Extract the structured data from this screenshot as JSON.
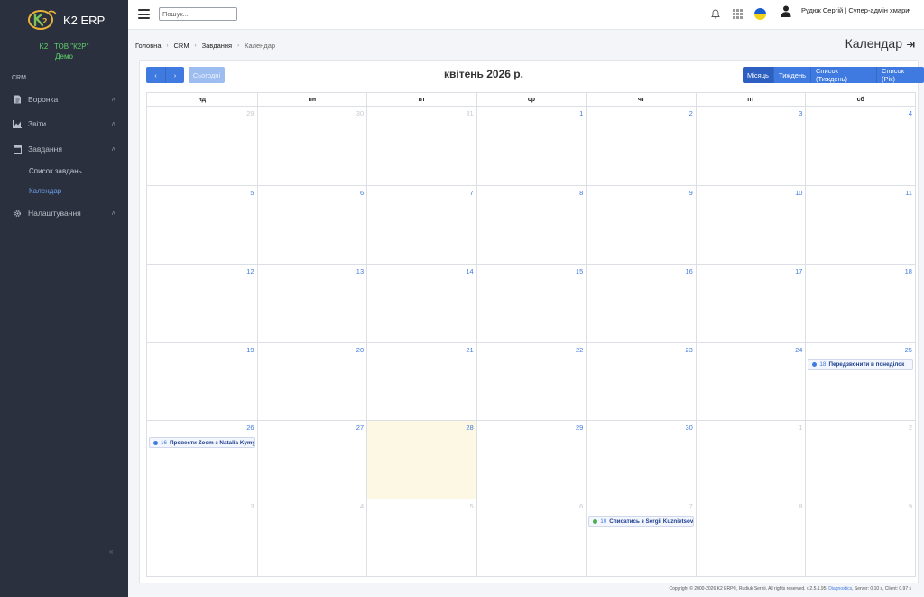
{
  "app": {
    "name": "K2 ERP",
    "company": "K2 : ТОВ \"К2Р\"",
    "env": "Демо"
  },
  "sidebar": {
    "section": "CRM",
    "items": [
      {
        "label": "Воронка",
        "icon": "document-icon"
      },
      {
        "label": "Звіти",
        "icon": "chart-icon"
      },
      {
        "label": "Завдання",
        "icon": "calendar-icon"
      },
      {
        "label": "Налаштування",
        "icon": "gear-icon"
      }
    ],
    "subitems": [
      {
        "label": "Список завдань",
        "active": false
      },
      {
        "label": "Календар",
        "active": true
      }
    ],
    "collapse": "«"
  },
  "topbar": {
    "search_placeholder": "Пошук...",
    "user": "Рудюк Сергій | Супер-адмін хмари",
    "user_chevron": "⌄"
  },
  "breadcrumb": [
    "Головна",
    "CRM",
    "Завдання",
    "Календар"
  ],
  "page_title": "Календар",
  "calendar": {
    "prev": "‹",
    "next": "›",
    "today_label": "Сьогодні",
    "title": "квітень 2026 р.",
    "views": [
      "Місяць",
      "Тиждень",
      "Список (Тиждень)",
      "Список (Рік)"
    ],
    "active_view": "Місяць",
    "weekdays": [
      "нд",
      "пн",
      "вт",
      "ср",
      "чт",
      "пт",
      "сб"
    ],
    "weeks": [
      [
        {
          "d": "29",
          "o": true
        },
        {
          "d": "30",
          "o": true
        },
        {
          "d": "31",
          "o": true
        },
        {
          "d": "1"
        },
        {
          "d": "2"
        },
        {
          "d": "3"
        },
        {
          "d": "4"
        }
      ],
      [
        {
          "d": "5"
        },
        {
          "d": "6"
        },
        {
          "d": "7"
        },
        {
          "d": "8"
        },
        {
          "d": "9"
        },
        {
          "d": "10"
        },
        {
          "d": "11"
        }
      ],
      [
        {
          "d": "12"
        },
        {
          "d": "13"
        },
        {
          "d": "14"
        },
        {
          "d": "15"
        },
        {
          "d": "16"
        },
        {
          "d": "17"
        },
        {
          "d": "18"
        }
      ],
      [
        {
          "d": "19"
        },
        {
          "d": "20"
        },
        {
          "d": "21"
        },
        {
          "d": "22"
        },
        {
          "d": "23"
        },
        {
          "d": "24"
        },
        {
          "d": "25",
          "event": {
            "time": "18",
            "title": "Передзвонити в понеділок",
            "color": "#3f7ae0"
          }
        }
      ],
      [
        {
          "d": "26",
          "event": {
            "time": "16",
            "title": "Провести Zoom з Natalia Kymych",
            "color": "#3f7ae0"
          }
        },
        {
          "d": "27"
        },
        {
          "d": "28",
          "today": true
        },
        {
          "d": "29"
        },
        {
          "d": "30"
        },
        {
          "d": "1",
          "o": true
        },
        {
          "d": "2",
          "o": true
        }
      ],
      [
        {
          "d": "3",
          "o": true
        },
        {
          "d": "4",
          "o": true
        },
        {
          "d": "5",
          "o": true
        },
        {
          "d": "6",
          "o": true
        },
        {
          "d": "7",
          "o": true,
          "event": {
            "time": "10",
            "title": "Списатись з Sergii Kuznietsov",
            "color": "#4cae4f"
          }
        },
        {
          "d": "8",
          "o": true
        },
        {
          "d": "9",
          "o": true
        }
      ]
    ]
  },
  "footer": {
    "text": "Copyright © 2000-2026 K2 ERP®, Rudiuk Serhii. All rights reserved. v.2.5.1.95.",
    "link": "Diagnostics",
    "stats": "Server: 0.10 s, Client: 0.97 s"
  },
  "colors": {
    "sidebar": "#2a303d",
    "accent": "#3f7ae0",
    "company": "#5fd06a",
    "today": "#fcf8e3"
  }
}
